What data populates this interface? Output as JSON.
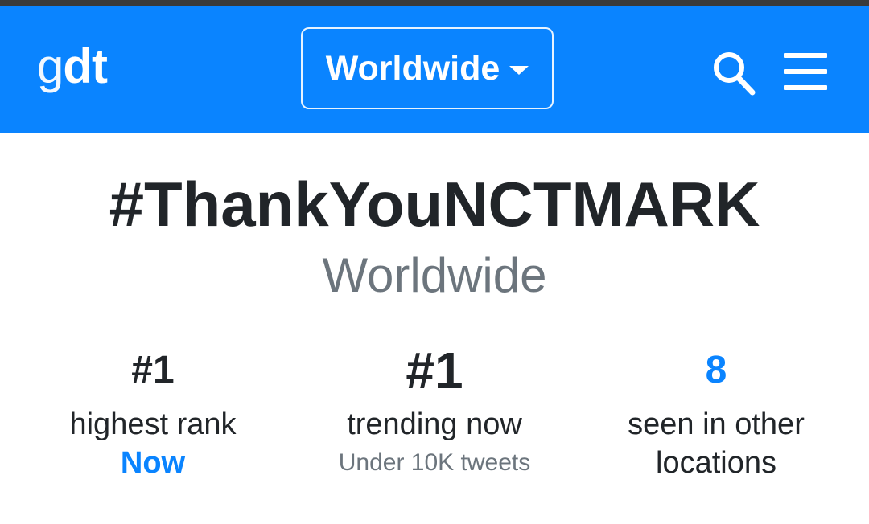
{
  "header": {
    "logo_thin": "g",
    "logo_bold": "dt",
    "location_label": "Worldwide",
    "brand_color": "#0a84ff",
    "icons": [
      "search-icon",
      "hamburger-menu-icon",
      "chevron-down-icon"
    ]
  },
  "trend": {
    "name": "#ThankYouNCTMARK",
    "location": "Worldwide"
  },
  "stats": {
    "highest_rank": {
      "value": "#1",
      "label": "highest rank",
      "sub": "Now"
    },
    "trending_now": {
      "value": "#1",
      "label": "trending now",
      "note": "Under 10K tweets"
    },
    "other_locations": {
      "value": "8",
      "label_line1": "seen in other",
      "label_line2": "locations"
    }
  }
}
